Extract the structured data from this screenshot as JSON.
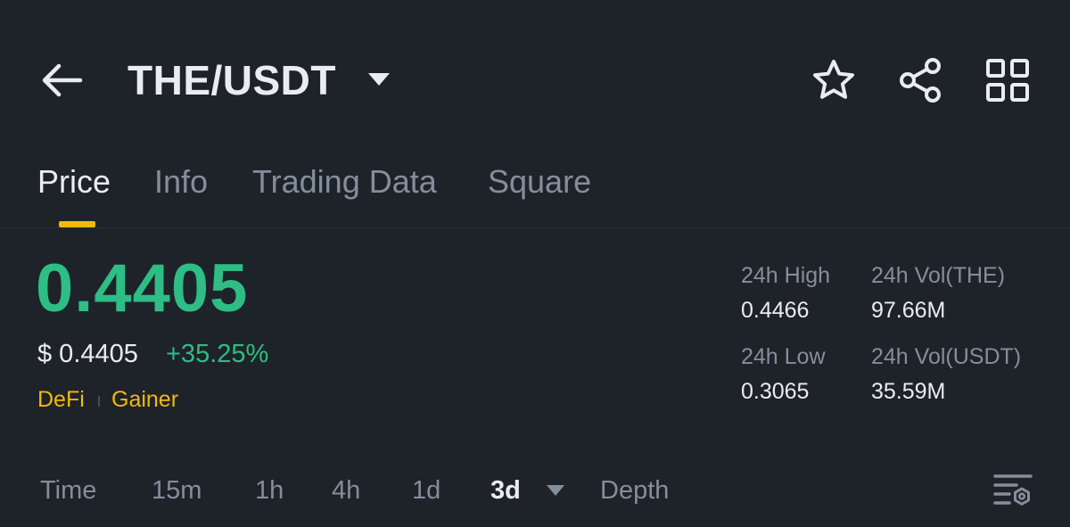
{
  "header": {
    "pair": "THE/USDT",
    "icons": [
      "arrow-left-icon",
      "caret-down-icon",
      "star-icon",
      "share-icon",
      "grid-icon"
    ]
  },
  "tabs": [
    {
      "label": "Price",
      "active": true
    },
    {
      "label": "Info",
      "active": false
    },
    {
      "label": "Trading Data",
      "active": false
    },
    {
      "label": "Square",
      "active": false
    }
  ],
  "price": {
    "last": "0.4405",
    "usd": "$ 0.4405",
    "change": "+35.25%",
    "tags": [
      "DeFi",
      "Gainer"
    ]
  },
  "stats": {
    "high_label": "24h High",
    "high_value": "0.4466",
    "low_label": "24h Low",
    "low_value": "0.3065",
    "vol_base_label": "24h Vol(THE)",
    "vol_base_value": "97.66M",
    "vol_quote_label": "24h Vol(USDT)",
    "vol_quote_value": "35.59M"
  },
  "intervals": {
    "items": [
      "Time",
      "15m",
      "1h",
      "4h",
      "1d",
      "3d",
      "Depth"
    ],
    "selected": "3d"
  },
  "colors": {
    "background": "#1e2329",
    "up": "#2ebd85",
    "accent": "#f0b90b",
    "muted": "#848e9c",
    "text": "#eaecef"
  }
}
